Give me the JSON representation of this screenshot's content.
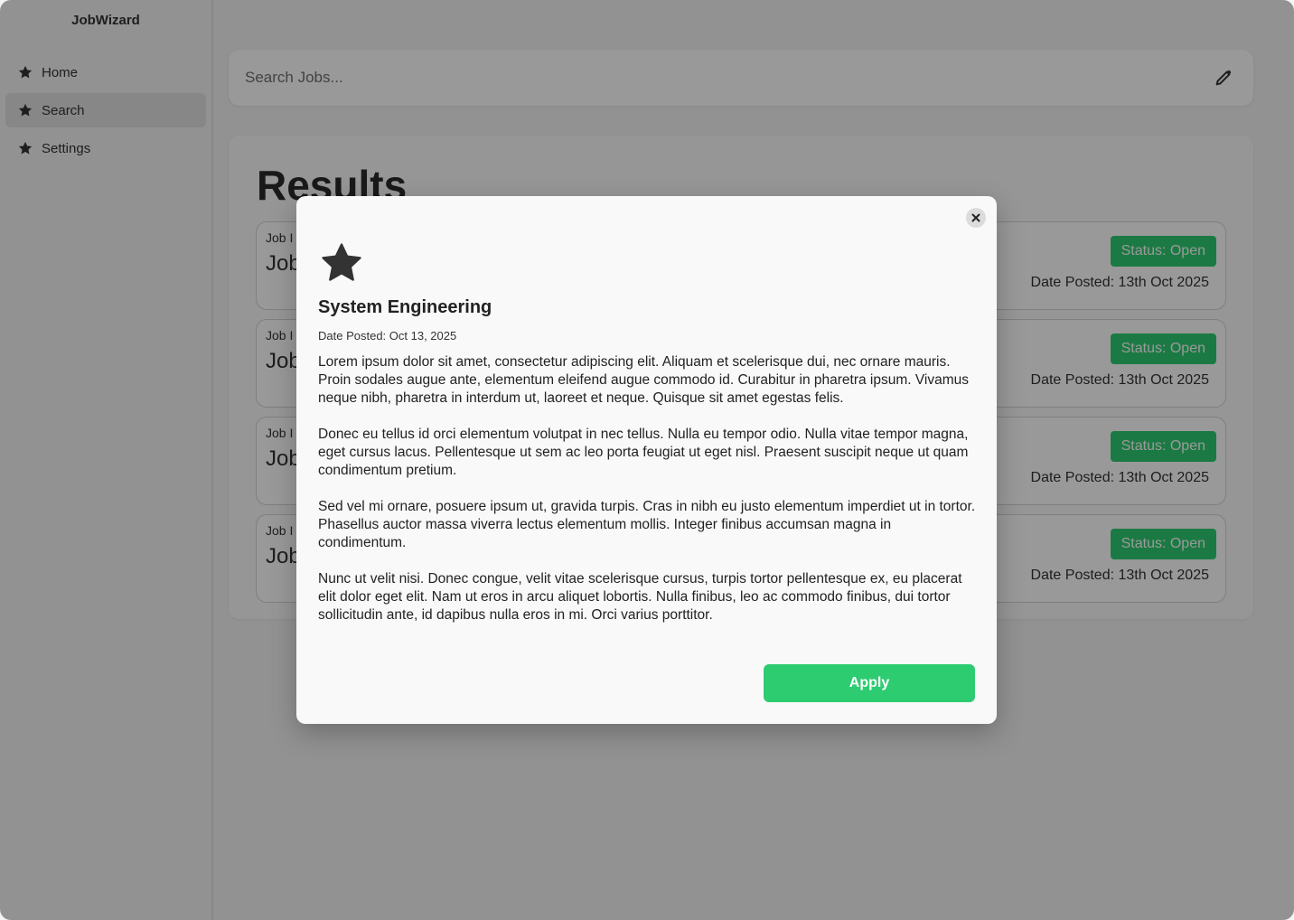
{
  "app": {
    "brand": "JobWizard"
  },
  "sidebar": {
    "items": [
      {
        "label": "Home",
        "icon": "star-icon",
        "active": false
      },
      {
        "label": "Search",
        "icon": "star-icon",
        "active": true
      },
      {
        "label": "Settings",
        "icon": "star-icon",
        "active": false
      }
    ]
  },
  "search": {
    "placeholder": "Search Jobs...",
    "value": "",
    "icon": "pencil-icon"
  },
  "results": {
    "title": "Results",
    "cards": [
      {
        "label": "Job I",
        "title": "Job",
        "status": "Status: Open",
        "date": "Date Posted: 13th Oct 2025"
      },
      {
        "label": "Job I",
        "title": "Job",
        "status": "Status: Open",
        "date": "Date Posted: 13th Oct 2025"
      },
      {
        "label": "Job I",
        "title": "Job",
        "status": "Status: Open",
        "date": "Date Posted: 13th Oct 2025"
      },
      {
        "label": "Job I",
        "title": "Job",
        "status": "Status: Open",
        "date": "Date Posted: 13th Oct 2025"
      }
    ]
  },
  "modal": {
    "icon": "star-icon",
    "title": "System Engineering",
    "date": "Date Posted: Oct 13, 2025",
    "paragraphs": [
      "Lorem ipsum dolor sit amet, consectetur adipiscing elit. Aliquam et scelerisque dui, nec ornare mauris. Proin sodales augue ante, elementum eleifend augue commodo id. Curabitur in pharetra ipsum. Vivamus neque nibh, pharetra in interdum ut, laoreet et neque. Quisque sit amet egestas felis.",
      "Donec eu tellus id orci elementum volutpat in nec tellus. Nulla eu tempor odio. Nulla vitae tempor magna, eget cursus lacus. Pellentesque ut sem ac leo porta feugiat ut eget nisl. Praesent suscipit neque ut quam condimentum pretium.",
      "Sed vel mi ornare, posuere ipsum ut, gravida turpis. Cras in nibh eu justo elementum imperdiet ut in tortor. Phasellus auctor massa viverra lectus elementum mollis. Integer finibus accumsan magna in condimentum.",
      "Nunc ut velit nisi. Donec congue, velit vitae scelerisque cursus, turpis tortor pellentesque ex, eu placerat elit dolor eget elit. Nam ut eros in arcu aliquet lobortis. Nulla finibus, leo ac commodo finibus, dui tortor sollicitudin ante, id dapibus nulla eros in mi. Orci varius porttitor."
    ],
    "apply_label": "Apply",
    "close_icon": "close-icon"
  },
  "colors": {
    "accent": "#2ecc71",
    "overlay": "rgba(0,0,0,0.40)"
  }
}
